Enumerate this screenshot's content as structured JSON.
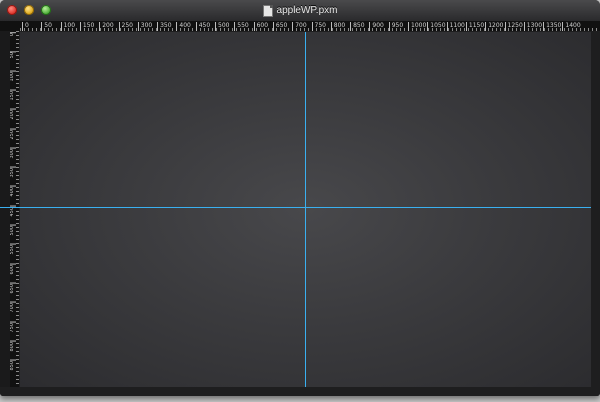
{
  "window": {
    "title": "appleWP.pxm",
    "controls": {
      "close_icon": "close-icon",
      "minimize_icon": "minimize-icon",
      "zoom_icon": "zoom-icon"
    },
    "accent_guide_color": "#3ab0f0"
  },
  "ruler": {
    "horizontal_labels": [
      "0",
      "50",
      "100",
      "150",
      "200",
      "250",
      "300",
      "350",
      "400",
      "450",
      "500",
      "550",
      "600",
      "650",
      "700",
      "750",
      "800",
      "850",
      "900",
      "950",
      "1000",
      "1050",
      "1100",
      "1150",
      "1200",
      "1250",
      "1300",
      "1350",
      "1400"
    ],
    "vertical_labels": [
      "0",
      "50",
      "100",
      "150",
      "200",
      "250",
      "300",
      "350",
      "400",
      "450",
      "500",
      "550",
      "600",
      "650",
      "700",
      "750",
      "800",
      "850"
    ]
  }
}
